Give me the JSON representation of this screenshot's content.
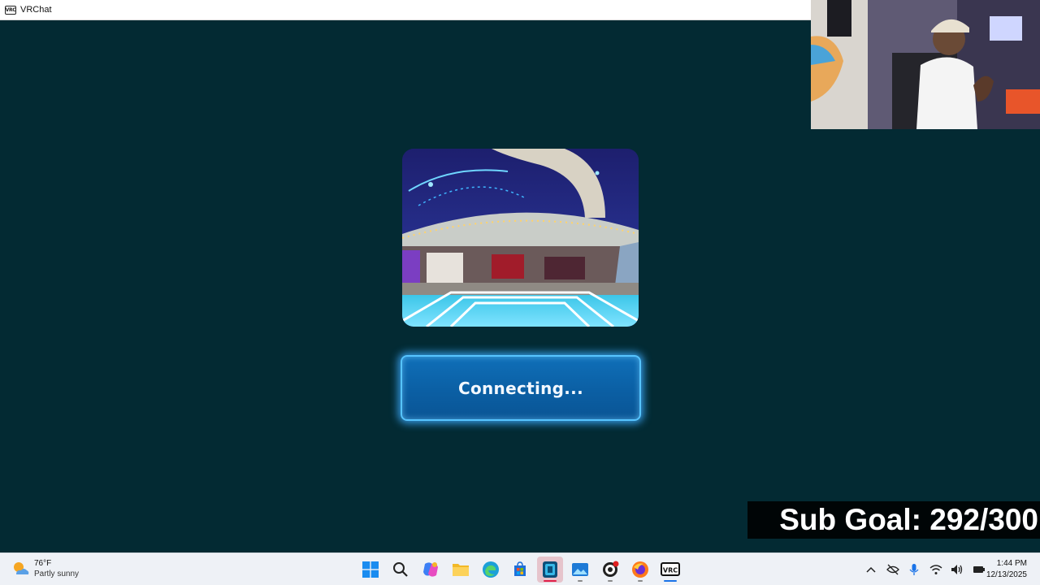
{
  "window": {
    "title": "VRChat",
    "app_icon_text": "VRC"
  },
  "main": {
    "button_label": "Connecting..."
  },
  "overlay": {
    "sub_goal": "Sub Goal: 292/300"
  },
  "taskbar": {
    "weather": {
      "temp": "76°F",
      "condition": "Partly sunny",
      "icon": "partly-sunny-icon"
    },
    "pinned": [
      {
        "name": "start",
        "icon": "windows-start-icon"
      },
      {
        "name": "search",
        "icon": "search-icon"
      },
      {
        "name": "copilot",
        "icon": "copilot-icon"
      },
      {
        "name": "file-explorer",
        "icon": "folder-icon"
      },
      {
        "name": "edge",
        "icon": "edge-icon"
      },
      {
        "name": "store",
        "icon": "store-icon"
      },
      {
        "name": "vrchat-active",
        "icon": "app-icon"
      },
      {
        "name": "paint-app",
        "icon": "photos-icon"
      },
      {
        "name": "obs",
        "icon": "obs-icon"
      },
      {
        "name": "firefox",
        "icon": "firefox-icon"
      },
      {
        "name": "vrc",
        "icon": "vrc-icon"
      }
    ],
    "vrc_icon_text": "VRC",
    "time": "1:44 PM",
    "date": "12/13/2025"
  },
  "colors": {
    "background": "#032a33",
    "button": "#0b5fa4",
    "button_glow": "#56c4ff",
    "taskbar": "#eef1f6"
  }
}
